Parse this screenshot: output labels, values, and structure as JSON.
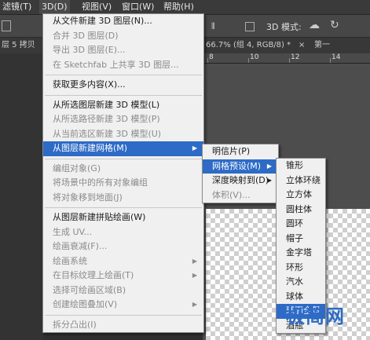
{
  "menubar": {
    "items": [
      {
        "label": "滤镜(T)",
        "active": false
      },
      {
        "label": "3D(D)",
        "active": true
      },
      {
        "label": "视图(V)",
        "active": false
      },
      {
        "label": "窗口(W)",
        "active": false
      },
      {
        "label": "帮助(H)",
        "active": false
      }
    ]
  },
  "optionsbar": {
    "mode_label": "3D 模式:"
  },
  "doc_tabs": {
    "left_tab": "层 5 拷贝",
    "zoom_info": "66.7% (组 4, RGB/8) *",
    "right_tab": "第一",
    "close_icon": "×"
  },
  "ruler": {
    "ticks": [
      "8",
      "10",
      "12",
      "14"
    ]
  },
  "menu_3d": {
    "groups": [
      [
        {
          "label": "从文件新建 3D 图层(N)...",
          "disabled": false
        },
        {
          "label": "合并 3D 图层(D)",
          "disabled": true
        },
        {
          "label": "导出 3D 图层(E)...",
          "disabled": true
        },
        {
          "label": "在 Sketchfab 上共享 3D 图层...",
          "disabled": true
        }
      ],
      [
        {
          "label": "获取更多内容(X)...",
          "disabled": false
        }
      ],
      [
        {
          "label": "从所选图层新建 3D 模型(L)",
          "disabled": false
        },
        {
          "label": "从所选路径新建 3D 模型(P)",
          "disabled": true
        },
        {
          "label": "从当前选区新建 3D 模型(U)",
          "disabled": true
        },
        {
          "label": "从图层新建网格(M)",
          "disabled": false,
          "submenu": true,
          "highlighted": true
        }
      ],
      [
        {
          "label": "编组对象(G)",
          "disabled": true
        },
        {
          "label": "将场景中的所有对象编组",
          "disabled": true
        },
        {
          "label": "将对象移到地面(J)",
          "disabled": true
        }
      ],
      [
        {
          "label": "从图层新建拼贴绘画(W)",
          "disabled": false
        },
        {
          "label": "生成 UV...",
          "disabled": true
        },
        {
          "label": "绘画衰减(F)...",
          "disabled": true
        },
        {
          "label": "绘画系统",
          "disabled": true,
          "submenu": true
        },
        {
          "label": "在目标纹理上绘画(T)",
          "disabled": true,
          "submenu": true
        },
        {
          "label": "选择可绘画区域(B)",
          "disabled": true
        },
        {
          "label": "创建绘图叠加(V)",
          "disabled": true,
          "submenu": true
        }
      ],
      [
        {
          "label": "拆分凸出(I)",
          "disabled": true
        }
      ]
    ]
  },
  "submenu_mesh": {
    "items": [
      {
        "label": "明信片(P)",
        "disabled": false
      },
      {
        "label": "网格预设(M)",
        "disabled": false,
        "submenu": true,
        "highlighted": true
      },
      {
        "label": "深度映射到(D)",
        "disabled": false,
        "submenu": true
      },
      {
        "label": "体积(V)...",
        "disabled": true
      }
    ]
  },
  "submenu_presets": {
    "items": [
      {
        "label": "锥形",
        "highlighted": false
      },
      {
        "label": "立体环绕",
        "highlighted": false
      },
      {
        "label": "立方体",
        "highlighted": false
      },
      {
        "label": "圆柱体",
        "highlighted": false
      },
      {
        "label": "圆环",
        "highlighted": false
      },
      {
        "label": "帽子",
        "highlighted": false
      },
      {
        "label": "金字塔",
        "highlighted": false
      },
      {
        "label": "环形",
        "highlighted": false
      },
      {
        "label": "汽水",
        "highlighted": false
      },
      {
        "label": "球体",
        "highlighted": false
      },
      {
        "label": "球面全景",
        "highlighted": true
      },
      {
        "label": "酒瓶",
        "highlighted": false
      }
    ]
  },
  "watermark": {
    "text": "极简网"
  },
  "colors": {
    "highlight": "#2d6bc6",
    "menu_bg": "#f0f0f0",
    "disabled_text": "#8a8a8a"
  },
  "icons": {
    "submenu_arrow": "▶"
  }
}
